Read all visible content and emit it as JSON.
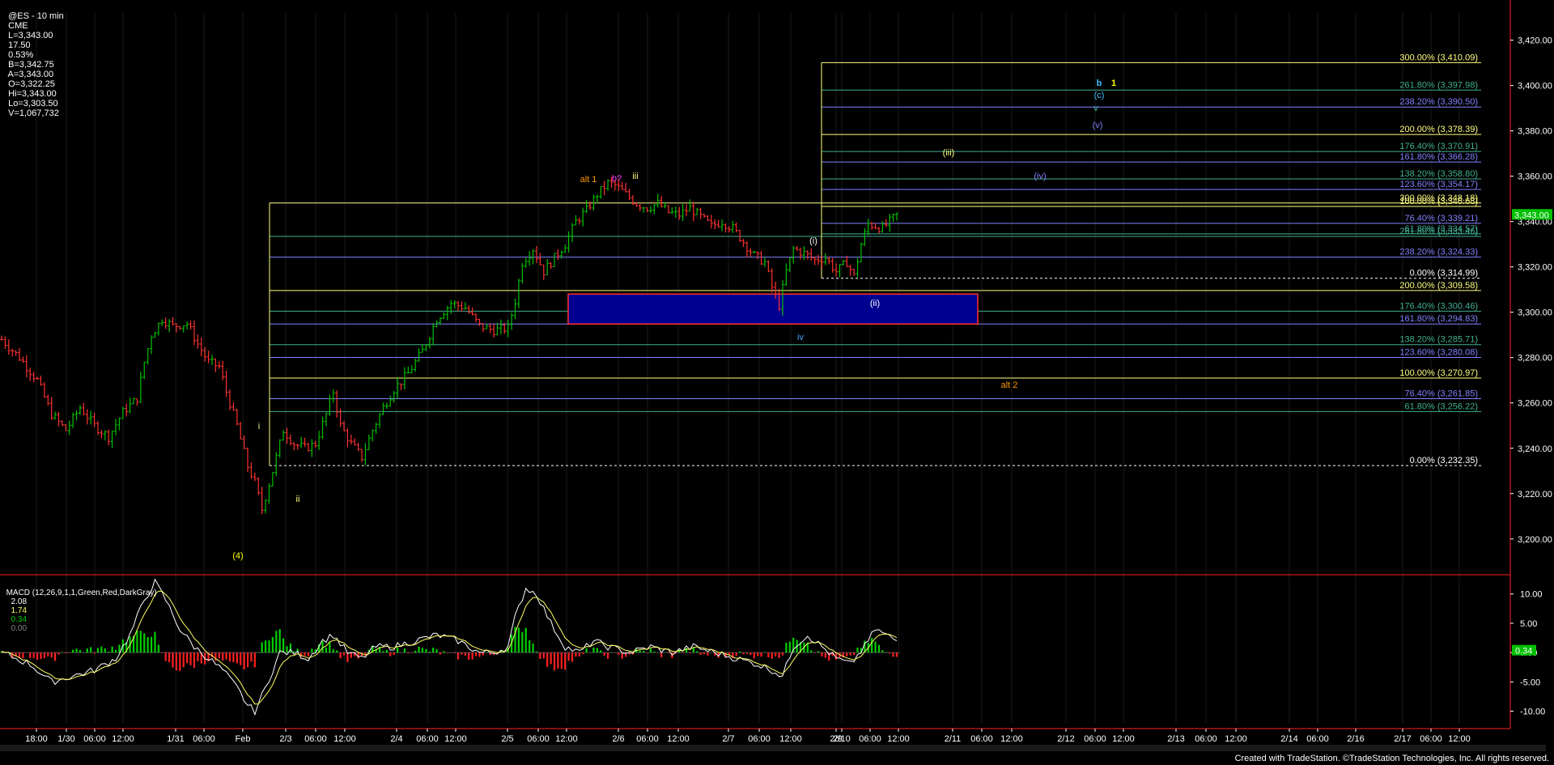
{
  "header": {
    "symbol": "@ES - 10 min",
    "exchange": "CME",
    "last": "L=3,343.00",
    "change": "17.50",
    "change_pct": "0.53%",
    "bid": "B=3,342.75",
    "ask": "A=3,343.00",
    "open": "O=3,322.25",
    "high": "Hi=3,343.00",
    "low": "Lo=3,303.50",
    "volume": "V=1,067,732"
  },
  "macd_header": {
    "label": "MACD (12,26,9,1,1,Green,Red,DarkGray)",
    "v1": "2.08",
    "v2": "1.74",
    "v3": "0.34",
    "v4": "0.00"
  },
  "credit": "Created with TradeStation. ©TradeStation Technologies, Inc. All rights reserved.",
  "colors": {
    "background": "#000000",
    "up_bar": "#00c000",
    "down_bar": "#ff3030",
    "fib_yellow": "#ffff80",
    "fib_blue": "#8080ff",
    "fib_teal": "#40c0a0",
    "blue_box": "#000090",
    "last_price_bg": "#00c000"
  },
  "chart_data": [
    {
      "type": "candlestick",
      "title": "",
      "price_axis": {
        "range": [
          3190,
          3430
        ],
        "ticks": [
          "3,420.00",
          "3,400.00",
          "3,380.00",
          "3,360.00",
          "3,340.00",
          "3,320.00",
          "3,300.00",
          "3,280.00",
          "3,260.00",
          "3,240.00",
          "3,220.00",
          "3,200.00"
        ],
        "last_price_tag": "3,343.00"
      },
      "time_axis": {
        "ticks": [
          "18:00",
          "1/30",
          "06:00",
          "12:00",
          "1/31",
          "06:00",
          "Feb",
          "2/3",
          "06:00",
          "12:00",
          "2/4",
          "06:00",
          "12:00",
          "2/5",
          "06:00",
          "12:00",
          "2/6",
          "06:00",
          "12:00",
          "2/7",
          "06:00",
          "12:00",
          "2/9",
          "2/10",
          "06:00",
          "12:00",
          "2/11",
          "06:00",
          "12:00",
          "2/12",
          "06:00",
          "12:00",
          "2/13",
          "06:00",
          "12:00",
          "2/14",
          "06:00",
          "2/16",
          "2/17",
          "06:00",
          "12:00"
        ]
      },
      "price_path": [
        [
          0,
          3288
        ],
        [
          5,
          3280
        ],
        [
          10,
          3270
        ],
        [
          14,
          3255
        ],
        [
          18,
          3248
        ],
        [
          22,
          3258
        ],
        [
          26,
          3250
        ],
        [
          30,
          3245
        ],
        [
          34,
          3256
        ],
        [
          38,
          3262
        ],
        [
          40,
          3278
        ],
        [
          42,
          3290
        ],
        [
          45,
          3297
        ],
        [
          48,
          3294
        ],
        [
          52,
          3295
        ],
        [
          55,
          3286
        ],
        [
          58,
          3278
        ],
        [
          61,
          3276
        ],
        [
          63,
          3265
        ],
        [
          66,
          3250
        ],
        [
          69,
          3232
        ],
        [
          71,
          3225
        ],
        [
          73,
          3213
        ],
        [
          76,
          3230
        ],
        [
          79,
          3248
        ],
        [
          82,
          3242
        ],
        [
          85,
          3240
        ],
        [
          88,
          3242
        ],
        [
          91,
          3255
        ],
        [
          93,
          3265
        ],
        [
          95,
          3250
        ],
        [
          98,
          3242
        ],
        [
          101,
          3236
        ],
        [
          104,
          3248
        ],
        [
          107,
          3258
        ],
        [
          110,
          3266
        ],
        [
          114,
          3273
        ],
        [
          118,
          3283
        ],
        [
          122,
          3297
        ],
        [
          126,
          3304
        ],
        [
          130,
          3302
        ],
        [
          134,
          3294
        ],
        [
          138,
          3292
        ],
        [
          142,
          3293
        ],
        [
          144,
          3305
        ],
        [
          146,
          3322
        ],
        [
          149,
          3328
        ],
        [
          152,
          3318
        ],
        [
          155,
          3324
        ],
        [
          158,
          3330
        ],
        [
          161,
          3340
        ],
        [
          164,
          3345
        ],
        [
          167,
          3352
        ],
        [
          170,
          3357
        ],
        [
          172,
          3356
        ],
        [
          175,
          3352
        ],
        [
          178,
          3348
        ],
        [
          181,
          3346
        ],
        [
          184,
          3348
        ],
        [
          187,
          3344
        ],
        [
          190,
          3343
        ],
        [
          193,
          3346
        ],
        [
          196,
          3342
        ],
        [
          199,
          3338
        ],
        [
          202,
          3340
        ],
        [
          205,
          3337
        ],
        [
          208,
          3331
        ],
        [
          211,
          3325
        ],
        [
          214,
          3322
        ],
        [
          216,
          3311
        ],
        [
          218,
          3303
        ],
        [
          220,
          3318
        ],
        [
          222,
          3328
        ],
        [
          225,
          3326
        ],
        [
          228,
          3323
        ],
        [
          231,
          3324
        ],
        [
          234,
          3318
        ],
        [
          237,
          3322
        ],
        [
          239,
          3316
        ],
        [
          241,
          3330
        ],
        [
          243,
          3339
        ],
        [
          245,
          3338
        ],
        [
          247,
          3337
        ],
        [
          249,
          3340
        ],
        [
          251,
          3343
        ]
      ],
      "fib_levels": [
        {
          "label": "300.00% (3,410.09)",
          "price": 3410.09,
          "color": "yellow",
          "x_start": "2/9",
          "x_end": "right"
        },
        {
          "label": "261.80% (3,397.98)",
          "price": 3397.98,
          "color": "teal",
          "x_start": "2/9",
          "x_end": "right"
        },
        {
          "label": "238.20% (3,390.50)",
          "price": 3390.5,
          "color": "blue",
          "x_start": "2/9",
          "x_end": "right"
        },
        {
          "label": "200.00% (3,378.39)",
          "price": 3378.39,
          "color": "yellow",
          "x_start": "2/9",
          "x_end": "right"
        },
        {
          "label": "176.40% (3,370.91)",
          "price": 3370.91,
          "color": "teal",
          "x_start": "2/9",
          "x_end": "right"
        },
        {
          "label": "161.80% (3,366.28)",
          "price": 3366.28,
          "color": "blue",
          "x_start": "2/9",
          "x_end": "right"
        },
        {
          "label": "138.20% (3,358.80)",
          "price": 3358.8,
          "color": "teal",
          "x_start": "2/9",
          "x_end": "right"
        },
        {
          "label": "123.60% (3,354.17)",
          "price": 3354.17,
          "color": "blue",
          "x_start": "2/9",
          "x_end": "right"
        },
        {
          "label": "100.00% (3,346.68)",
          "price": 3346.68,
          "color": "yellow",
          "x_start": "2/9",
          "x_end": "right"
        },
        {
          "label": "300.00% (3,348.18)",
          "price": 3348.18,
          "color": "yellow",
          "x_start": "2/3",
          "x_end": "right"
        },
        {
          "label": "76.40% (3,339.21)",
          "price": 3339.21,
          "color": "blue",
          "x_start": "2/9",
          "x_end": "right"
        },
        {
          "label": "261.80% (3,333.46)",
          "price": 3333.46,
          "color": "teal",
          "x_start": "2/3",
          "x_end": "right"
        },
        {
          "label": "61.80% (3,334.57)",
          "price": 3334.57,
          "color": "teal",
          "x_start": "2/9",
          "x_end": "right"
        },
        {
          "label": "238.20% (3,324.33)",
          "price": 3324.33,
          "color": "blue",
          "x_start": "2/3",
          "x_end": "right"
        },
        {
          "label": "0.00% (3,314.99)",
          "price": 3314.99,
          "color": "white-dashed",
          "x_start": "2/9",
          "x_end": "right"
        },
        {
          "label": "200.00% (3,309.58)",
          "price": 3309.58,
          "color": "yellow",
          "x_start": "2/3",
          "x_end": "right"
        },
        {
          "label": "176.40% (3,300.46)",
          "price": 3300.46,
          "color": "teal",
          "x_start": "2/3",
          "x_end": "right"
        },
        {
          "label": "161.80% (3,294.83)",
          "price": 3294.83,
          "color": "blue",
          "x_start": "2/3",
          "x_end": "right"
        },
        {
          "label": "138.20% (3,285.71)",
          "price": 3285.71,
          "color": "teal",
          "x_start": "2/3",
          "x_end": "right"
        },
        {
          "label": "123.60% (3,280.08)",
          "price": 3280.08,
          "color": "blue",
          "x_start": "2/3",
          "x_end": "right"
        },
        {
          "label": "100.00% (3,270.97)",
          "price": 3270.97,
          "color": "yellow",
          "x_start": "2/3",
          "x_end": "right"
        },
        {
          "label": "76.40% (3,261.85)",
          "price": 3261.85,
          "color": "blue",
          "x_start": "2/3",
          "x_end": "right"
        },
        {
          "label": "61.80% (3,256.22)",
          "price": 3256.22,
          "color": "teal",
          "x_start": "2/3",
          "x_end": "right"
        },
        {
          "label": "0.00% (3,232.35)",
          "price": 3232.35,
          "color": "white-dashed",
          "x_start": "2/3",
          "x_end": "right"
        }
      ],
      "target_box": {
        "price_top": 3308,
        "price_bottom": 3294.8,
        "x_start": "2/5",
        "x_end": "2/10 12:00"
      },
      "wave_labels": [
        {
          "text": "(4)",
          "color": "#ffff00",
          "price": 3192,
          "x": "Feb"
        },
        {
          "text": "i",
          "color": "#ffff80",
          "price": 3253,
          "x": "2/3"
        },
        {
          "text": "ii",
          "color": "#ffff80",
          "price": 3225,
          "x": "2/3 06:00"
        },
        {
          "text": "alt 1",
          "color": "#ff9900",
          "price": 3359,
          "x": "2/5 12:00"
        },
        {
          "text": "b?",
          "color": "#ff40ff",
          "price": 3359,
          "x": "2/6"
        },
        {
          "text": "iii",
          "color": "#ffff80",
          "price": 3360,
          "x": "2/6"
        },
        {
          "text": "iv",
          "color": "#40a0ff",
          "price": 3298,
          "x": "2/9"
        },
        {
          "text": "(i)",
          "color": "#ffffff",
          "price": 3343,
          "x": "2/9"
        },
        {
          "text": "(ii)",
          "color": "#ffffff",
          "price": 3310,
          "x": "2/10 06:00"
        },
        {
          "text": "(iii)",
          "color": "#ffff80",
          "price": 3378,
          "x": "2/11"
        },
        {
          "text": "(iv)",
          "color": "#8080ff",
          "price": 3366,
          "x": "2/11 12:00"
        },
        {
          "text": "(v)",
          "color": "#8080ff",
          "price": 3390,
          "x": "2/12 06:00"
        },
        {
          "text": "v",
          "color": "#40c0a0",
          "price": 3396,
          "x": "2/12 06:00"
        },
        {
          "text": "(c)",
          "color": "#40c0ff",
          "price": 3403,
          "x": "2/12 06:00"
        },
        {
          "text": "b",
          "color": "#40c0ff",
          "price": 3410,
          "x": "2/12 06:00"
        },
        {
          "text": "1",
          "color": "#ffff00",
          "price": 3410,
          "x": "2/12 12:00"
        },
        {
          "text": "alt 2",
          "color": "#ff9900",
          "price": 3276,
          "x": "2/11"
        }
      ],
      "macd": {
        "axis_ticks": [
          "10.00",
          "5.00",
          "0.00",
          "-5.00",
          "-10.00"
        ],
        "range": [
          -12,
          13
        ],
        "last_value_tag": "0.34",
        "line_series": [
          [
            0,
            0
          ],
          [
            8,
            -2
          ],
          [
            14,
            -5
          ],
          [
            20,
            -4
          ],
          [
            26,
            -3
          ],
          [
            32,
            -1
          ],
          [
            36,
            3
          ],
          [
            40,
            9
          ],
          [
            43,
            12
          ],
          [
            46,
            9
          ],
          [
            50,
            4
          ],
          [
            54,
            1
          ],
          [
            58,
            -1
          ],
          [
            62,
            -3
          ],
          [
            66,
            -6
          ],
          [
            69,
            -9
          ],
          [
            71,
            -10
          ],
          [
            74,
            -6
          ],
          [
            78,
            0
          ],
          [
            82,
            0
          ],
          [
            86,
            -1
          ],
          [
            90,
            2
          ],
          [
            93,
            3
          ],
          [
            97,
            0
          ],
          [
            101,
            -1
          ],
          [
            105,
            1
          ],
          [
            110,
            1
          ],
          [
            116,
            2
          ],
          [
            122,
            3
          ],
          [
            128,
            2
          ],
          [
            134,
            0
          ],
          [
            138,
            0
          ],
          [
            142,
            1
          ],
          [
            144,
            6
          ],
          [
            147,
            11
          ],
          [
            150,
            10
          ],
          [
            154,
            5
          ],
          [
            158,
            1
          ],
          [
            162,
            0
          ],
          [
            166,
            2
          ],
          [
            170,
            1
          ],
          [
            176,
            0
          ],
          [
            182,
            1
          ],
          [
            188,
            0
          ],
          [
            194,
            1
          ],
          [
            200,
            0
          ],
          [
            206,
            -1
          ],
          [
            212,
            -2
          ],
          [
            216,
            -3
          ],
          [
            219,
            -4
          ],
          [
            222,
            1
          ],
          [
            226,
            3
          ],
          [
            230,
            1
          ],
          [
            234,
            -1
          ],
          [
            238,
            -2
          ],
          [
            242,
            1
          ],
          [
            245,
            4
          ],
          [
            248,
            3
          ],
          [
            251,
            2
          ]
        ]
      }
    }
  ]
}
